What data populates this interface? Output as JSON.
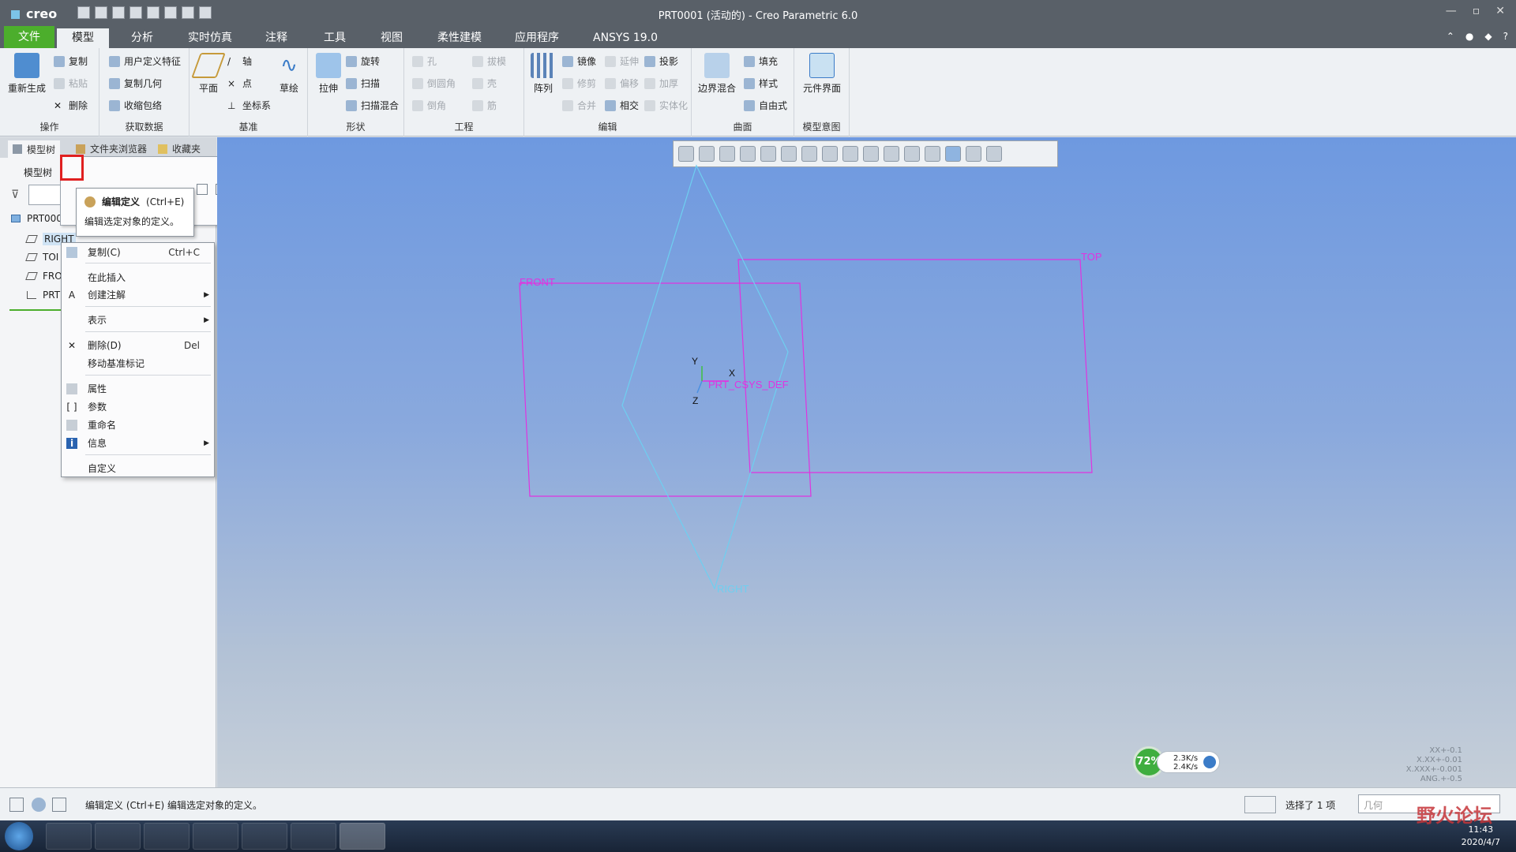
{
  "window": {
    "brand": "creo",
    "title": "PRT0001 (活动的) - Creo Parametric 6.0"
  },
  "tabs": [
    "文件",
    "模型",
    "分析",
    "实时仿真",
    "注释",
    "工具",
    "视图",
    "柔性建模",
    "应用程序",
    "ANSYS 19.0"
  ],
  "ribbon": {
    "ops": {
      "regen": "重新生成",
      "copy": "复制",
      "paste": "粘贴",
      "delete": "删除",
      "label": "操作"
    },
    "getdata": {
      "udf": "用户定义特征",
      "copygeom": "复制几何",
      "shrink": "收缩包络",
      "label": "获取数据"
    },
    "datum": {
      "plane": "平面",
      "axis": "轴",
      "point": "点",
      "csys": "坐标系",
      "sketch": "草绘",
      "label": "基准"
    },
    "shapes": {
      "extrude": "拉伸",
      "revolve": "旋转",
      "sweep": "扫描",
      "blend": "扫描混合",
      "label": "形状"
    },
    "eng": {
      "hole": "孔",
      "round": "倒圆角",
      "chamfer": "倒角",
      "draft": "拔模",
      "shell": "壳",
      "rib": "筋",
      "label": "工程"
    },
    "edit": {
      "pattern": "阵列",
      "mirror": "镜像",
      "trim": "修剪",
      "merge": "合并",
      "extend": "延伸",
      "offset": "偏移",
      "intersect": "相交",
      "project": "投影",
      "thicken": "加厚",
      "solidify": "实体化",
      "label": "编辑"
    },
    "surf": {
      "boundary": "边界混合",
      "fill": "填充",
      "style": "样式",
      "freestyle": "自由式",
      "label": "曲面"
    },
    "intent": {
      "component": "元件界面",
      "label": "模型意图"
    }
  },
  "panel": {
    "tabs": [
      "模型树",
      "文件夹浏览器",
      "收藏夹"
    ],
    "treelabel": "模型树",
    "items": [
      "PRT000",
      "RIGHT",
      "TOI",
      "FRO",
      "PRT"
    ]
  },
  "tooltip": {
    "title": "编辑定义",
    "key": "(Ctrl+E)",
    "desc": "编辑选定对象的定义。"
  },
  "menu": {
    "copy": "复制(C)",
    "copy_key": "Ctrl+C",
    "insert": "在此插入",
    "annot": "创建注解",
    "display": "表示",
    "delete": "删除(D)",
    "delete_key": "Del",
    "movedatum": "移动基准标记",
    "props": "属性",
    "params": "参数",
    "rename": "重命名",
    "info": "信息",
    "custom": "自定义"
  },
  "graphics": {
    "labels": {
      "top": "TOP",
      "front": "FRONT",
      "right": "RIGHT",
      "csys": "PRT_CSYS_DEF",
      "x": "X",
      "y": "Y",
      "z": "Z"
    },
    "colors": {
      "datum_plane": "#e033e0",
      "right_plane": "#6ecff0",
      "csys": "#e033e0"
    },
    "gauge": {
      "percent": "72%",
      "up": "2.3K/s",
      "down": "2.4K/s"
    },
    "tolerances": [
      "XX+-0.1",
      "X.XX+-0.01",
      "X.XXX+-0.001",
      "ANG.+-0.5"
    ]
  },
  "status": {
    "message": "编辑定义 (Ctrl+E) 编辑选定对象的定义。",
    "selection": "选择了 1 项",
    "filter_placeholder": "几何"
  },
  "taskbar": {
    "time": "11:43",
    "date": "2020/4/7"
  },
  "watermark": "野火论坛"
}
